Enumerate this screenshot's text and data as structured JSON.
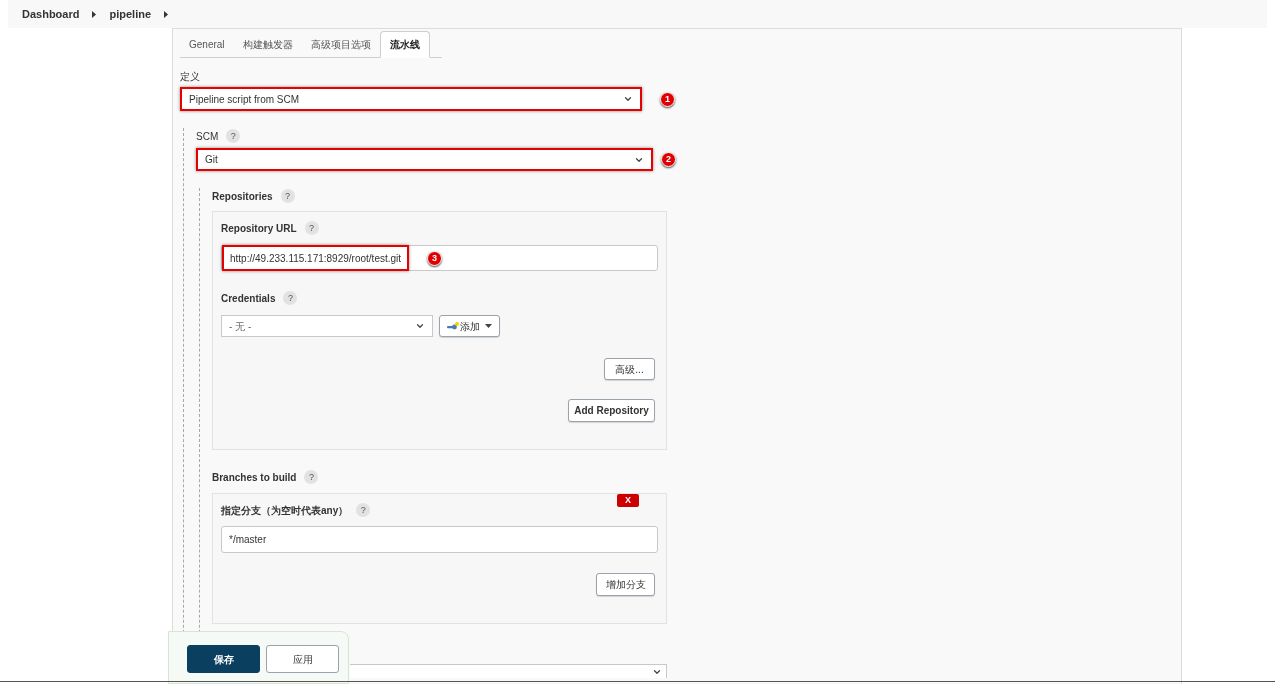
{
  "breadcrumb": [
    {
      "label": "Dashboard"
    },
    {
      "label": "pipeline"
    }
  ],
  "tabs": [
    {
      "label": "General",
      "selected": false
    },
    {
      "label": "构建触发器",
      "selected": false
    },
    {
      "label": "高级项目选项",
      "selected": false
    },
    {
      "label": "流水线",
      "selected": true
    }
  ],
  "definition": {
    "label": "定义",
    "select": {
      "value": "Pipeline script from SCM",
      "highlighted": true,
      "marker": "1"
    }
  },
  "scm": {
    "label": "SCM",
    "help": "?",
    "select": {
      "value": "Git",
      "highlighted": true,
      "marker": "2"
    }
  },
  "repositories": {
    "label": "Repositories",
    "help": "?",
    "url": {
      "label": "Repository URL",
      "help": "?",
      "value": "http://49.233.115.171:8929/root/test.git",
      "highlighted": true,
      "marker": "3"
    },
    "credentials": {
      "label": "Credentials",
      "help": "?",
      "value": "- 无 -",
      "add_button": "添加"
    },
    "advanced_button": "高级...",
    "add_repository_button": "Add Repository"
  },
  "branches": {
    "label": "Branches to build",
    "help": "?",
    "delete_button": "X",
    "branch": {
      "label": "指定分支（为空时代表any）",
      "help": "?",
      "value": "*/master"
    },
    "add_branch_button": "增加分支"
  },
  "footer": {
    "buttons": [
      {
        "label": "保存",
        "kind": "primary"
      },
      {
        "label": "应用",
        "kind": "secondary"
      }
    ]
  }
}
